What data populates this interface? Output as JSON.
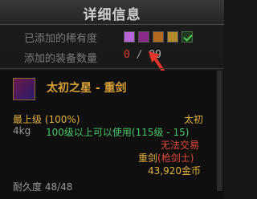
{
  "window": {
    "title": "详细信息"
  },
  "rarity": {
    "label": "已添加的稀有度",
    "swatches": [
      "#b565d8",
      "#8a2b8a",
      "#b26a21",
      "#b38a2a"
    ],
    "check_icon": "checkbox-check-icon"
  },
  "equipment_count": {
    "label": "添加的装备数量",
    "current": "0",
    "separator": "/",
    "max": "99"
  },
  "item": {
    "name": "太初之星 - 重剑",
    "grade": "最上级",
    "grade_percent": "(100%)",
    "rarity": "太初",
    "weight": "4kg",
    "level_req": "100级以上可以使用(115级 - 15)",
    "trade_status": "无法交易",
    "type": "重剑",
    "class": "(枪剑士)",
    "price": "43,920金币",
    "durability_label": "耐久度",
    "durability": "48/48"
  }
}
